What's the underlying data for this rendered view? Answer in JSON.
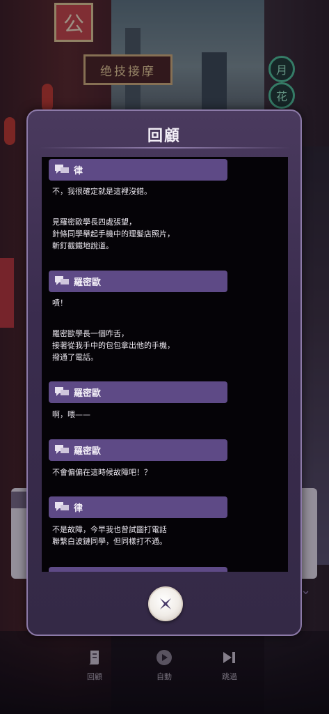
{
  "background": {
    "sign_gong": "公",
    "sign_top": "绝技接摩",
    "jade_signs": [
      "月",
      "花"
    ]
  },
  "review_panel": {
    "title": "回顧",
    "entries": [
      {
        "speaker": "律",
        "lines": [
          "不，我很確定就是這裡沒錯。",
          "",
          "見羅密歐學長四處張望，",
          "針條同學舉起手機中的理髮店照片，",
          "斬釘截鐵地說道。"
        ]
      },
      {
        "speaker": "羅密歐",
        "lines": [
          "嘖！",
          "",
          "羅密歐學長一個咋舌，",
          "接著從我手中的包包拿出他的手機，",
          "撥通了電話。"
        ]
      },
      {
        "speaker": "羅密歐",
        "lines": [
          "啊，喂——"
        ]
      },
      {
        "speaker": "羅密歐",
        "lines": [
          "不會偏偏在這時候故障吧！？"
        ]
      },
      {
        "speaker": "律",
        "lines": [
          "不是故障，今早我也曾試圖打電話",
          "聯繫白波鏈同學，但同樣打不通。"
        ]
      }
    ]
  },
  "bottom_bar": {
    "review_label": "回顧",
    "auto_label": "自動",
    "skip_label": "跳過"
  },
  "colors": {
    "panel": "#3a2c4e",
    "speaker_bar": "#5e4a86",
    "log_bg": "#050307"
  }
}
